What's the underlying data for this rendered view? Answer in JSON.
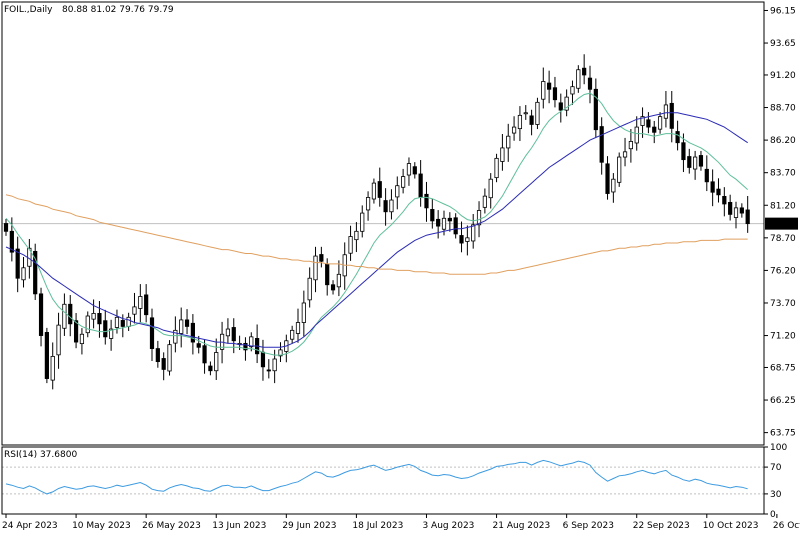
{
  "header": {
    "symbol": "FOIL.,Daily",
    "ohlc": "80.88 81.02 79.76 79.79",
    "rsi_label": "RSI(14) 37.6800"
  },
  "colors": {
    "candle": "#000000",
    "ma_fast": "#5fbf9a",
    "ma_mid": "#2b2bb5",
    "ma_slow": "#e0a060",
    "rsi": "#3d9be0",
    "price_label_bg": "#000000",
    "price_label_fg": "#ffffff",
    "level_line": "#c0c0c0"
  },
  "chart_data": [
    {
      "type": "candlestick",
      "title": "FOIL.,Daily",
      "y_ticks": [
        96.15,
        93.65,
        91.2,
        88.7,
        86.2,
        83.7,
        81.2,
        78.7,
        76.2,
        73.7,
        71.2,
        68.75,
        66.25,
        63.75
      ],
      "ylim": [
        62.8,
        96.8
      ],
      "x_tick_labels": [
        "24 Apr 2023",
        "10 May 2023",
        "26 May 2023",
        "13 Jun 2023",
        "29 Jun 2023",
        "18 Jul 2023",
        "3 Aug 2023",
        "21 Aug 2023",
        "6 Sep 2023",
        "22 Sep 2023",
        "10 Oct 2023",
        "26 Oct 2023"
      ],
      "x_tick_index": [
        0,
        12,
        24,
        36,
        48,
        60,
        72,
        84,
        96,
        108,
        120,
        132
      ],
      "last_price": 79.79,
      "last_price_label": "79.79",
      "closes": [
        79.2,
        77.6,
        75.6,
        76.4,
        77.9,
        74.4,
        71.2,
        67.9,
        69.6,
        72.0,
        73.6,
        72.1,
        70.7,
        71.3,
        72.7,
        72.9,
        72.1,
        71.1,
        71.7,
        72.6,
        71.9,
        72.6,
        73.4,
        74.2,
        72.8,
        70.2,
        69.2,
        68.6,
        70.5,
        71.6,
        72.4,
        71.9,
        70.7,
        70.3,
        69.1,
        68.5,
        69.9,
        71.3,
        71.7,
        70.8,
        70.6,
        70.1,
        71.1,
        69.8,
        68.8,
        68.5,
        69.4,
        70.1,
        70.8,
        71.6,
        72.2,
        73.7,
        75.6,
        77.3,
        76.9,
        75.1,
        74.7,
        75.9,
        77.4,
        78.8,
        79.2,
        80.6,
        81.8,
        82.9,
        81.8,
        80.7,
        81.6,
        82.7,
        83.4,
        84.4,
        83.6,
        81.8,
        81.0,
        80.0,
        79.6,
        80.2,
        80.0,
        79.0,
        78.3,
        78.7,
        79.7,
        80.8,
        81.9,
        83.2,
        84.8,
        85.6,
        86.5,
        87.2,
        88.1,
        88.3,
        87.4,
        89.1,
        90.7,
        90.1,
        89.3,
        88.5,
        89.5,
        90.3,
        91.6,
        91.2,
        90.1,
        87.0,
        84.5,
        82.1,
        83.2,
        84.9,
        85.3,
        86.1,
        87.2,
        88.0,
        87.2,
        86.8,
        88.0,
        88.9,
        87.1,
        86.0,
        84.7,
        84.1,
        84.9,
        84.2,
        83.0,
        82.2,
        82.0,
        81.3,
        80.5,
        81.0,
        80.6,
        79.79
      ],
      "series": [
        {
          "name": "MA fast",
          "values": [
            80.2,
            79.7,
            79.0,
            78.4,
            77.8,
            77.1,
            76.0,
            74.9,
            74.0,
            73.4,
            73.0,
            72.6,
            72.2,
            71.9,
            71.7,
            71.6,
            71.5,
            71.5,
            71.6,
            71.7,
            71.8,
            71.9,
            72.0,
            72.2,
            72.1,
            71.9,
            71.6,
            71.3,
            71.2,
            71.2,
            71.2,
            71.1,
            71.0,
            70.8,
            70.6,
            70.4,
            70.3,
            70.3,
            70.3,
            70.3,
            70.3,
            70.2,
            70.2,
            70.1,
            69.9,
            69.8,
            69.7,
            69.7,
            69.8,
            70.0,
            70.3,
            70.7,
            71.3,
            72.0,
            72.6,
            73.0,
            73.4,
            73.9,
            74.5,
            75.2,
            75.9,
            76.7,
            77.5,
            78.3,
            78.9,
            79.3,
            79.7,
            80.2,
            80.7,
            81.3,
            81.7,
            81.8,
            81.8,
            81.7,
            81.5,
            81.3,
            81.1,
            80.8,
            80.4,
            80.1,
            80.0,
            80.1,
            80.3,
            80.7,
            81.3,
            81.9,
            82.7,
            83.5,
            84.3,
            85.0,
            85.6,
            86.3,
            87.1,
            87.7,
            88.1,
            88.4,
            88.7,
            89.0,
            89.4,
            89.7,
            89.8,
            89.5,
            89.0,
            88.3,
            87.7,
            87.3,
            87.0,
            86.8,
            86.7,
            86.7,
            86.6,
            86.5,
            86.6,
            86.7,
            86.7,
            86.6,
            86.3,
            86.0,
            85.8,
            85.6,
            85.3,
            84.9,
            84.5,
            84.0,
            83.5,
            83.2,
            82.8,
            82.4
          ]
        },
        {
          "name": "MA mid",
          "values": [
            78.0,
            77.8,
            77.6,
            77.4,
            77.1,
            76.8,
            76.4,
            76.0,
            75.6,
            75.3,
            75.0,
            74.7,
            74.4,
            74.1,
            73.8,
            73.5,
            73.3,
            73.1,
            72.9,
            72.7,
            72.5,
            72.4,
            72.2,
            72.1,
            72.0,
            71.9,
            71.8,
            71.6,
            71.5,
            71.4,
            71.3,
            71.2,
            71.1,
            71.0,
            70.9,
            70.8,
            70.7,
            70.7,
            70.6,
            70.6,
            70.5,
            70.5,
            70.4,
            70.4,
            70.3,
            70.3,
            70.3,
            70.3,
            70.4,
            70.6,
            70.8,
            71.1,
            71.5,
            72.0,
            72.4,
            72.8,
            73.2,
            73.6,
            74.0,
            74.4,
            74.8,
            75.2,
            75.6,
            76.0,
            76.4,
            76.8,
            77.2,
            77.6,
            77.9,
            78.2,
            78.5,
            78.7,
            78.9,
            79.0,
            79.1,
            79.2,
            79.3,
            79.4,
            79.4,
            79.5,
            79.6,
            79.8,
            80.0,
            80.3,
            80.6,
            80.9,
            81.3,
            81.7,
            82.1,
            82.5,
            82.9,
            83.3,
            83.7,
            84.1,
            84.4,
            84.7,
            85.0,
            85.3,
            85.6,
            85.9,
            86.2,
            86.4,
            86.6,
            86.8,
            87.0,
            87.2,
            87.4,
            87.6,
            87.8,
            87.9,
            88.0,
            88.1,
            88.2,
            88.3,
            88.3,
            88.3,
            88.2,
            88.1,
            88.0,
            87.9,
            87.8,
            87.6,
            87.4,
            87.2,
            86.9,
            86.6,
            86.3,
            86.0
          ]
        },
        {
          "name": "MA slow",
          "values": [
            82.0,
            81.9,
            81.7,
            81.6,
            81.5,
            81.3,
            81.2,
            81.1,
            80.9,
            80.8,
            80.7,
            80.6,
            80.4,
            80.3,
            80.2,
            80.1,
            79.9,
            79.8,
            79.7,
            79.6,
            79.5,
            79.4,
            79.3,
            79.2,
            79.1,
            79.0,
            78.9,
            78.8,
            78.7,
            78.6,
            78.5,
            78.4,
            78.3,
            78.2,
            78.1,
            78.0,
            77.9,
            77.8,
            77.8,
            77.7,
            77.6,
            77.5,
            77.5,
            77.4,
            77.3,
            77.3,
            77.2,
            77.1,
            77.1,
            77.0,
            77.0,
            76.9,
            76.9,
            76.8,
            76.8,
            76.7,
            76.7,
            76.7,
            76.6,
            76.6,
            76.5,
            76.5,
            76.4,
            76.4,
            76.3,
            76.3,
            76.3,
            76.2,
            76.2,
            76.2,
            76.1,
            76.1,
            76.1,
            76.0,
            76.0,
            76.0,
            75.9,
            75.9,
            75.9,
            75.9,
            75.9,
            75.9,
            75.9,
            76.0,
            76.0,
            76.1,
            76.2,
            76.2,
            76.3,
            76.4,
            76.5,
            76.6,
            76.7,
            76.8,
            76.9,
            77.0,
            77.1,
            77.2,
            77.3,
            77.4,
            77.5,
            77.6,
            77.7,
            77.7,
            77.8,
            77.9,
            77.9,
            78.0,
            78.0,
            78.1,
            78.1,
            78.2,
            78.2,
            78.3,
            78.3,
            78.3,
            78.4,
            78.4,
            78.4,
            78.5,
            78.5,
            78.5,
            78.5,
            78.6,
            78.6,
            78.6,
            78.6,
            78.6
          ]
        }
      ]
    },
    {
      "type": "line",
      "title": "RSI(14) 37.6800",
      "y_ticks": [
        100,
        70,
        30,
        0
      ],
      "ylim": [
        0,
        100
      ],
      "series": [
        {
          "name": "RSI(14)",
          "values": [
            45,
            43,
            40,
            38,
            42,
            39,
            34,
            30,
            33,
            38,
            41,
            39,
            37,
            38,
            41,
            42,
            40,
            38,
            40,
            43,
            41,
            43,
            45,
            47,
            43,
            37,
            35,
            34,
            39,
            42,
            44,
            42,
            39,
            38,
            35,
            34,
            38,
            42,
            43,
            40,
            40,
            39,
            42,
            38,
            35,
            35,
            38,
            41,
            43,
            46,
            48,
            53,
            58,
            63,
            61,
            56,
            55,
            58,
            62,
            65,
            66,
            68,
            71,
            73,
            69,
            65,
            67,
            70,
            72,
            74,
            71,
            65,
            62,
            58,
            57,
            59,
            58,
            55,
            53,
            54,
            57,
            61,
            64,
            67,
            71,
            72,
            74,
            75,
            77,
            77,
            73,
            77,
            80,
            78,
            75,
            72,
            74,
            76,
            79,
            77,
            73,
            62,
            55,
            49,
            53,
            57,
            58,
            60,
            63,
            65,
            62,
            60,
            63,
            65,
            58,
            55,
            51,
            49,
            52,
            50,
            46,
            44,
            43,
            41,
            39,
            41,
            40,
            37.68
          ]
        }
      ]
    }
  ]
}
